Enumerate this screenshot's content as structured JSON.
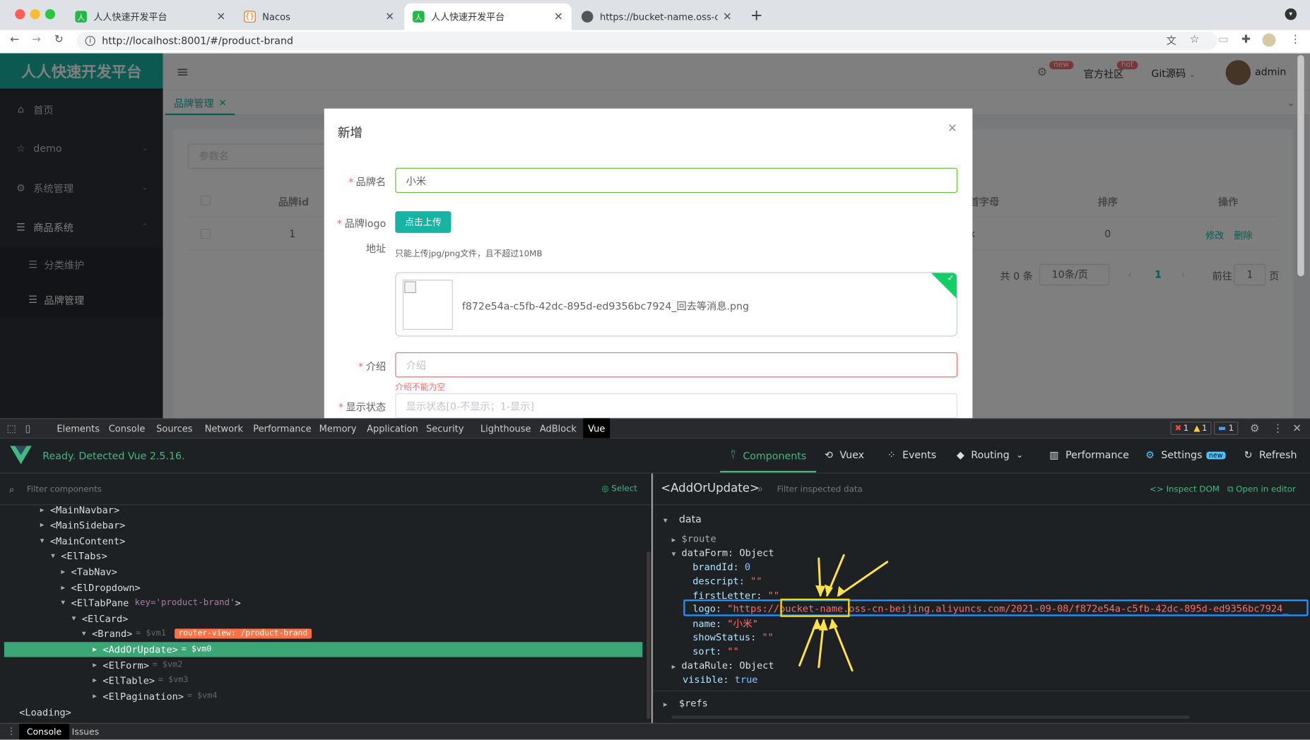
{
  "browser": {
    "tabs": [
      {
        "title": "人人快速开发平台",
        "icon": "renren-favicon",
        "active": false
      },
      {
        "title": "Nacos",
        "icon": "nacos-favicon",
        "active": false
      },
      {
        "title": "人人快速开发平台",
        "icon": "renren-favicon",
        "active": true
      },
      {
        "title": "https://bucket-name.oss-cn-be",
        "icon": "globe-icon",
        "active": false
      }
    ],
    "url": "http://localhost:8001/#/product-brand"
  },
  "app": {
    "logo": "人人快速开发平台",
    "menu": [
      {
        "label": "首页",
        "icon": "home-icon"
      },
      {
        "label": "demo",
        "icon": "star-icon"
      },
      {
        "label": "系统管理",
        "icon": "gear-icon"
      },
      {
        "label": "商品系统",
        "icon": "list-icon"
      }
    ],
    "submenu": [
      {
        "label": "分类维护"
      },
      {
        "label": "品牌管理"
      }
    ],
    "header": {
      "badge_new": "new",
      "community": "官方社区",
      "badge_hot": "hot",
      "git": "Git源码",
      "user": "admin"
    },
    "open_tab": "品牌管理",
    "search_placeholder": "参数名",
    "table": {
      "headers": [
        "品牌id",
        "首字母",
        "排序",
        "操作"
      ],
      "row": {
        "id": "1",
        "letter": "x",
        "sort": "0",
        "edit": "修改",
        "delete": "删除"
      }
    },
    "pagination": {
      "total": "共 0 条",
      "size": "10条/页",
      "page": "1",
      "goto": "前往",
      "goto_value": "1",
      "page_suffix": "页"
    }
  },
  "dialog": {
    "title": "新增",
    "fields": {
      "name_label": "品牌名",
      "name_value": "小米",
      "logo_label": "品牌logo",
      "logo_label2": "地址",
      "upload_button": "点击上传",
      "upload_tip": "只能上传jpg/png文件，且不超过10MB",
      "file_name": "f872e54a-c5fb-42dc-895d-ed9356bc7924_回去等消息.png",
      "descript_label": "介绍",
      "descript_placeholder": "介绍",
      "descript_error": "介绍不能为空",
      "show_label": "显示状态",
      "show_placeholder": "显示状态[0-不显示；1-显示]"
    }
  },
  "devtools": {
    "tabs": [
      "Elements",
      "Console",
      "Sources",
      "Network",
      "Performance",
      "Memory",
      "Application",
      "Security",
      "Lighthouse",
      "AdBlock",
      "Vue"
    ],
    "counts": {
      "errors": "1",
      "warnings": "1",
      "messages": "1"
    },
    "vue": {
      "status": "Ready. Detected Vue 2.5.16.",
      "nav": [
        "Components",
        "Vuex",
        "Events",
        "Routing",
        "Performance",
        "Settings",
        "Refresh"
      ],
      "settings_badge": "new",
      "filter_placeholder": "Filter components",
      "select": "Select",
      "selected_component": "<AddOrUpdate>",
      "filter_data_placeholder": "Filter inspected data",
      "inspect_dom": "Inspect DOM",
      "open_in_editor": "Open in editor",
      "tree": [
        {
          "name": "<MainNavbar>",
          "extra": ""
        },
        {
          "name": "<MainSidebar>",
          "extra": ""
        },
        {
          "name": "<MainContent>",
          "extra": ""
        },
        {
          "name": "<ElTabs>",
          "extra": ""
        },
        {
          "name": "<TabNav>",
          "extra": ""
        },
        {
          "name": "<ElDropdown>",
          "extra": ""
        },
        {
          "name": "<ElTabPane",
          "attr": "key='product-brand'",
          "close": ">"
        },
        {
          "name": "<ElCard>",
          "extra": ""
        },
        {
          "name": "<Brand>",
          "vm": "= $vm1",
          "badge": "router-view: /product-brand"
        },
        {
          "name": "<AddOrUpdate>",
          "vm": "= $vm0"
        },
        {
          "name": "<ElForm>",
          "vm": "= $vm2"
        },
        {
          "name": "<ElTable>",
          "vm": "= $vm3"
        },
        {
          "name": "<ElPagination>",
          "vm": "= $vm4"
        },
        {
          "name": "<Loading>",
          "extra": ""
        }
      ],
      "data": {
        "section": "data",
        "route": "$route",
        "dataForm": "dataForm: Object",
        "brandId": "0",
        "descript": "\"\"",
        "firstLetter": "\"\"",
        "logo": "\"https://bucket-name.oss-cn-beijing.aliyuncs.com/2021-09-08/f872e54a-c5fb-42dc-895d-ed9356bc7924_",
        "name": "\"小米\"",
        "showStatus": "\"\"",
        "sort": "\"\"",
        "dataRule": "dataRule: Object",
        "visible": "true",
        "refs": "$refs"
      }
    },
    "console_tabs": [
      "Console",
      "Issues"
    ]
  }
}
